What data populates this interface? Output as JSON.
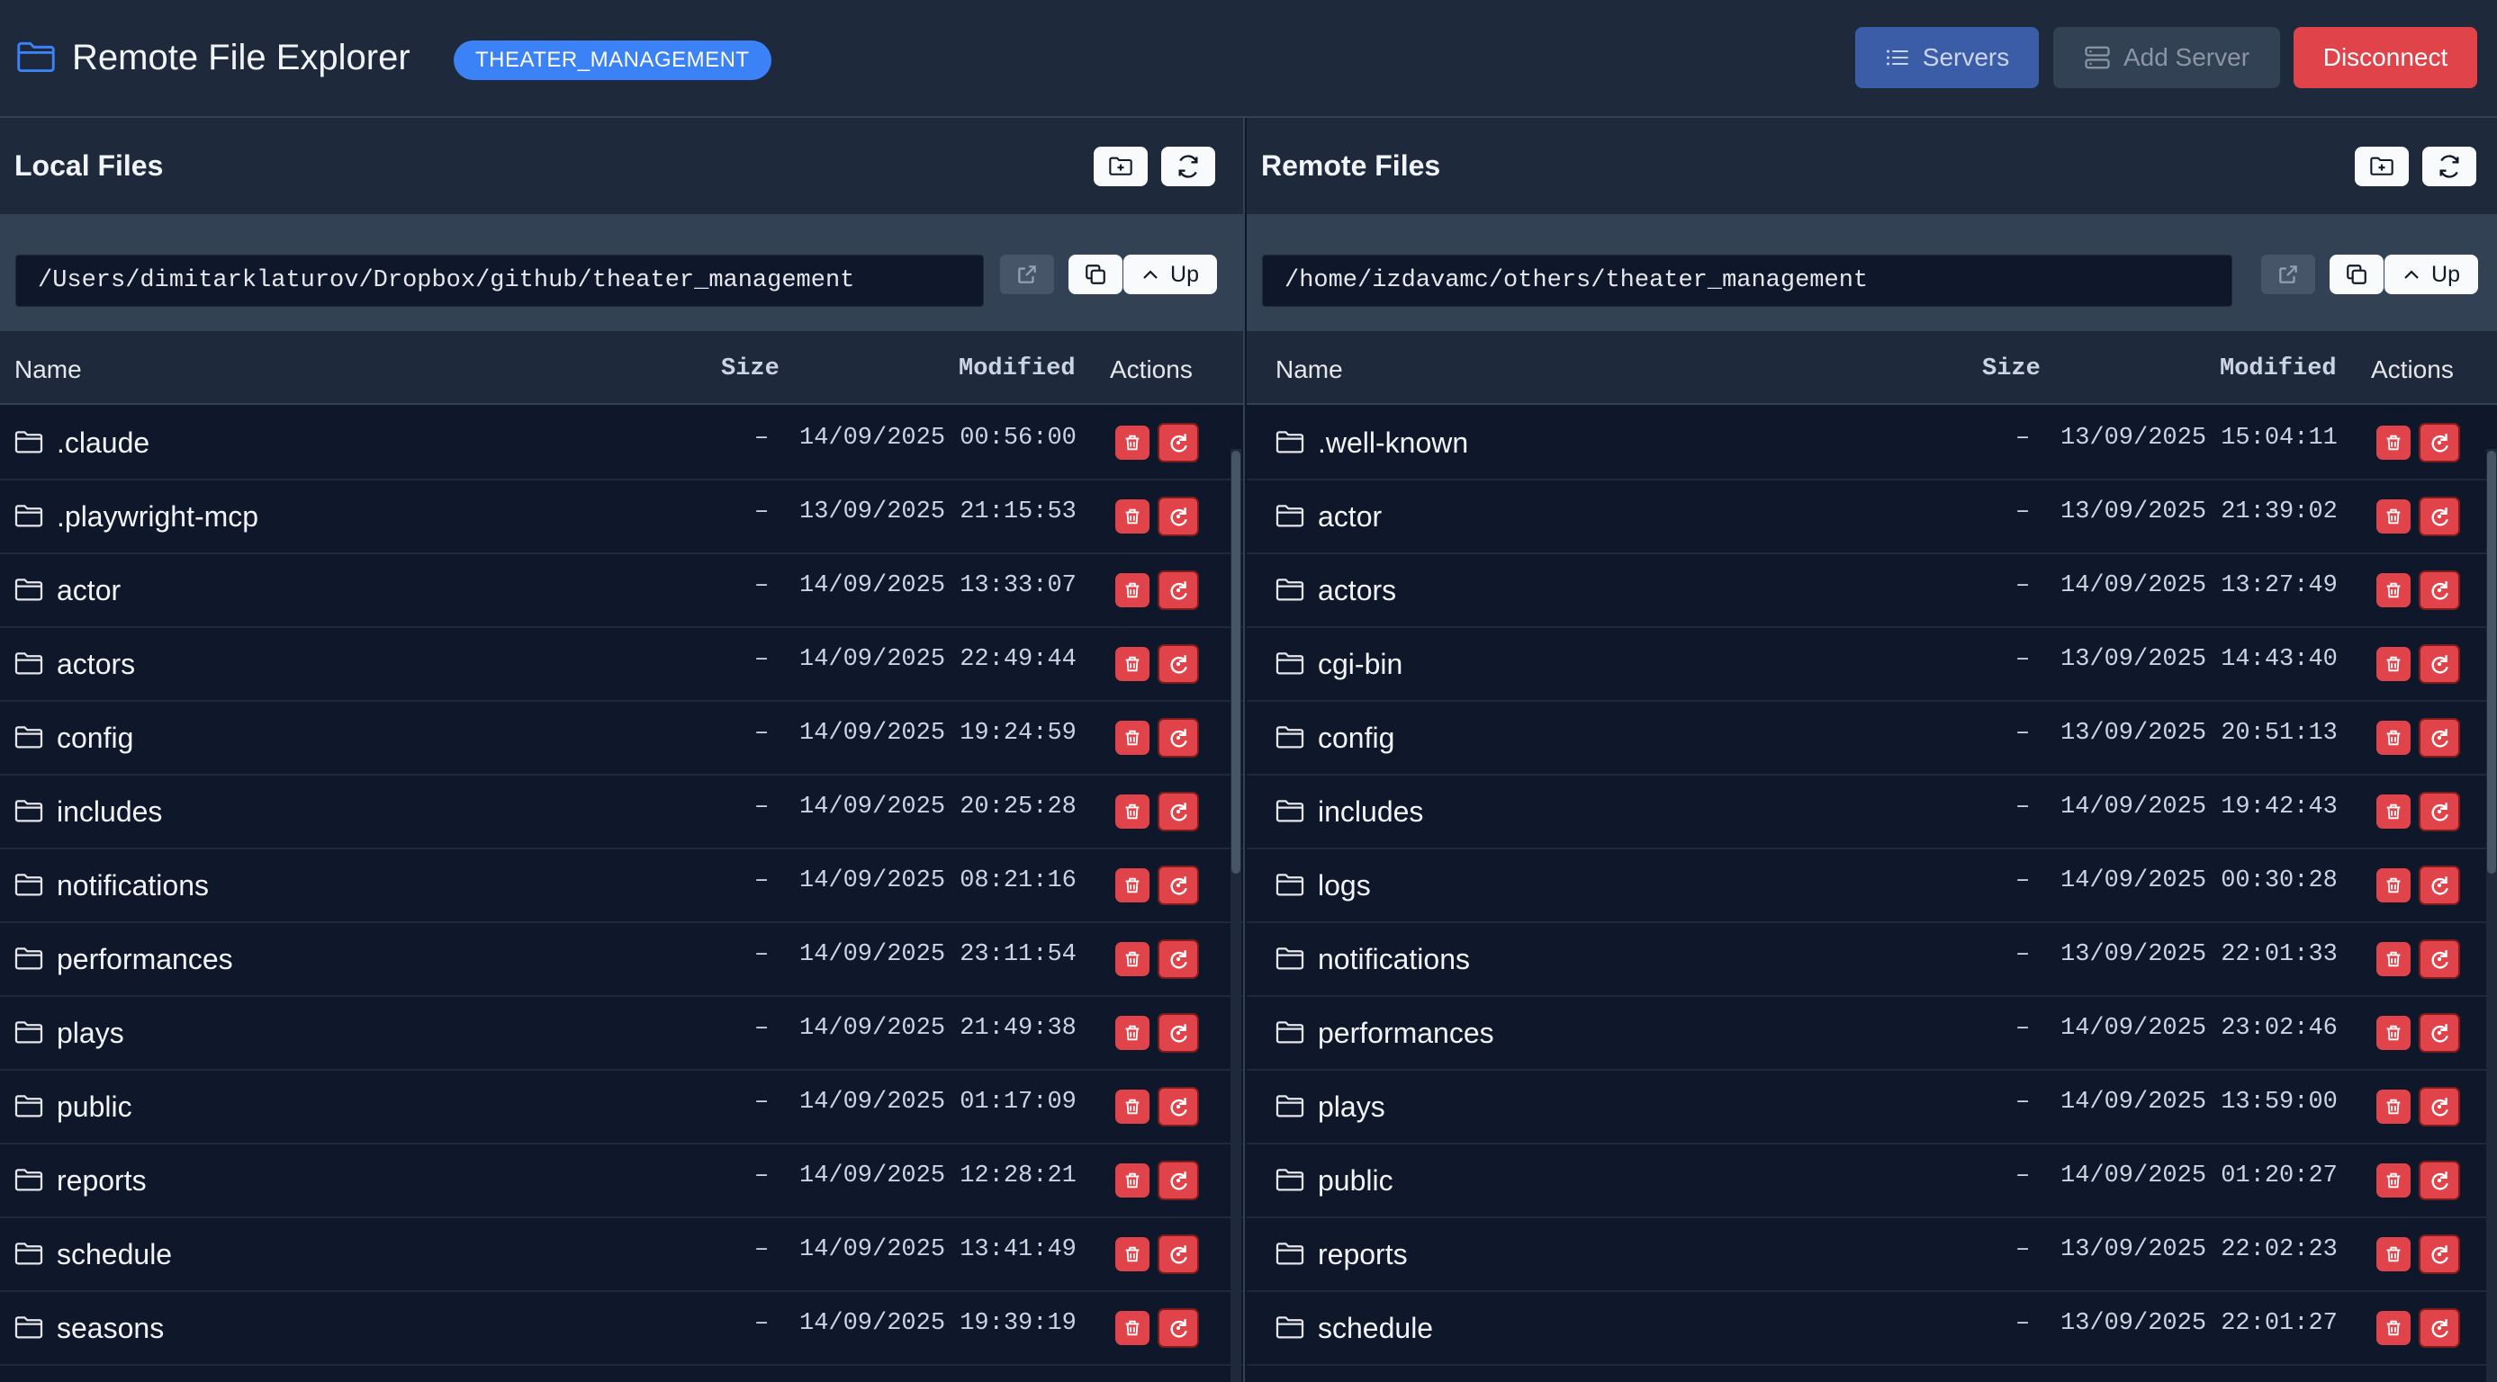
{
  "header": {
    "title": "Remote File Explorer",
    "project_badge": "THEATER_MANAGEMENT",
    "servers_label": "Servers",
    "add_server_label": "Add Server",
    "disconnect_label": "Disconnect"
  },
  "local": {
    "title": "Local Files",
    "path": "/Users/dimitarklaturov/Dropbox/github/theater_management",
    "up_label": "Up",
    "columns": {
      "name": "Name",
      "size": "Size",
      "modified": "Modified",
      "actions": "Actions"
    },
    "rows": [
      {
        "name": ".claude",
        "size": "–",
        "modified": "14/09/2025 00:56:00"
      },
      {
        "name": ".playwright-mcp",
        "size": "–",
        "modified": "13/09/2025 21:15:53"
      },
      {
        "name": "actor",
        "size": "–",
        "modified": "14/09/2025 13:33:07"
      },
      {
        "name": "actors",
        "size": "–",
        "modified": "14/09/2025 22:49:44"
      },
      {
        "name": "config",
        "size": "–",
        "modified": "14/09/2025 19:24:59"
      },
      {
        "name": "includes",
        "size": "–",
        "modified": "14/09/2025 20:25:28"
      },
      {
        "name": "notifications",
        "size": "–",
        "modified": "14/09/2025 08:21:16"
      },
      {
        "name": "performances",
        "size": "–",
        "modified": "14/09/2025 23:11:54"
      },
      {
        "name": "plays",
        "size": "–",
        "modified": "14/09/2025 21:49:38"
      },
      {
        "name": "public",
        "size": "–",
        "modified": "14/09/2025 01:17:09"
      },
      {
        "name": "reports",
        "size": "–",
        "modified": "14/09/2025 12:28:21"
      },
      {
        "name": "schedule",
        "size": "–",
        "modified": "14/09/2025 13:41:49"
      },
      {
        "name": "seasons",
        "size": "–",
        "modified": "14/09/2025 19:39:19"
      }
    ]
  },
  "remote": {
    "title": "Remote Files",
    "path": "/home/izdavamc/others/theater_management",
    "up_label": "Up",
    "columns": {
      "name": "Name",
      "size": "Size",
      "modified": "Modified",
      "actions": "Actions"
    },
    "rows": [
      {
        "name": ".well-known",
        "size": "–",
        "modified": "13/09/2025 15:04:11"
      },
      {
        "name": "actor",
        "size": "–",
        "modified": "13/09/2025 21:39:02"
      },
      {
        "name": "actors",
        "size": "–",
        "modified": "14/09/2025 13:27:49"
      },
      {
        "name": "cgi-bin",
        "size": "–",
        "modified": "13/09/2025 14:43:40"
      },
      {
        "name": "config",
        "size": "–",
        "modified": "13/09/2025 20:51:13"
      },
      {
        "name": "includes",
        "size": "–",
        "modified": "14/09/2025 19:42:43"
      },
      {
        "name": "logs",
        "size": "–",
        "modified": "14/09/2025 00:30:28"
      },
      {
        "name": "notifications",
        "size": "–",
        "modified": "13/09/2025 22:01:33"
      },
      {
        "name": "performances",
        "size": "–",
        "modified": "14/09/2025 23:02:46"
      },
      {
        "name": "plays",
        "size": "–",
        "modified": "14/09/2025 13:59:00"
      },
      {
        "name": "public",
        "size": "–",
        "modified": "14/09/2025 01:20:27"
      },
      {
        "name": "reports",
        "size": "–",
        "modified": "13/09/2025 22:02:23"
      },
      {
        "name": "schedule",
        "size": "–",
        "modified": "13/09/2025 22:01:27"
      }
    ]
  },
  "icons": {
    "brand": "folder-icon",
    "new_folder": "folder-plus-icon",
    "refresh": "refresh-icon",
    "open_external": "external-link-icon",
    "copy": "copy-icon",
    "up": "chevron-up-icon",
    "delete": "trash-icon",
    "sync": "sync-icon",
    "servers": "list-icon",
    "add_server": "server-icon"
  },
  "colors": {
    "background": "#0f172a",
    "surface": "#1e293b",
    "accent": "#3b82f6",
    "danger": "#e0444a"
  }
}
